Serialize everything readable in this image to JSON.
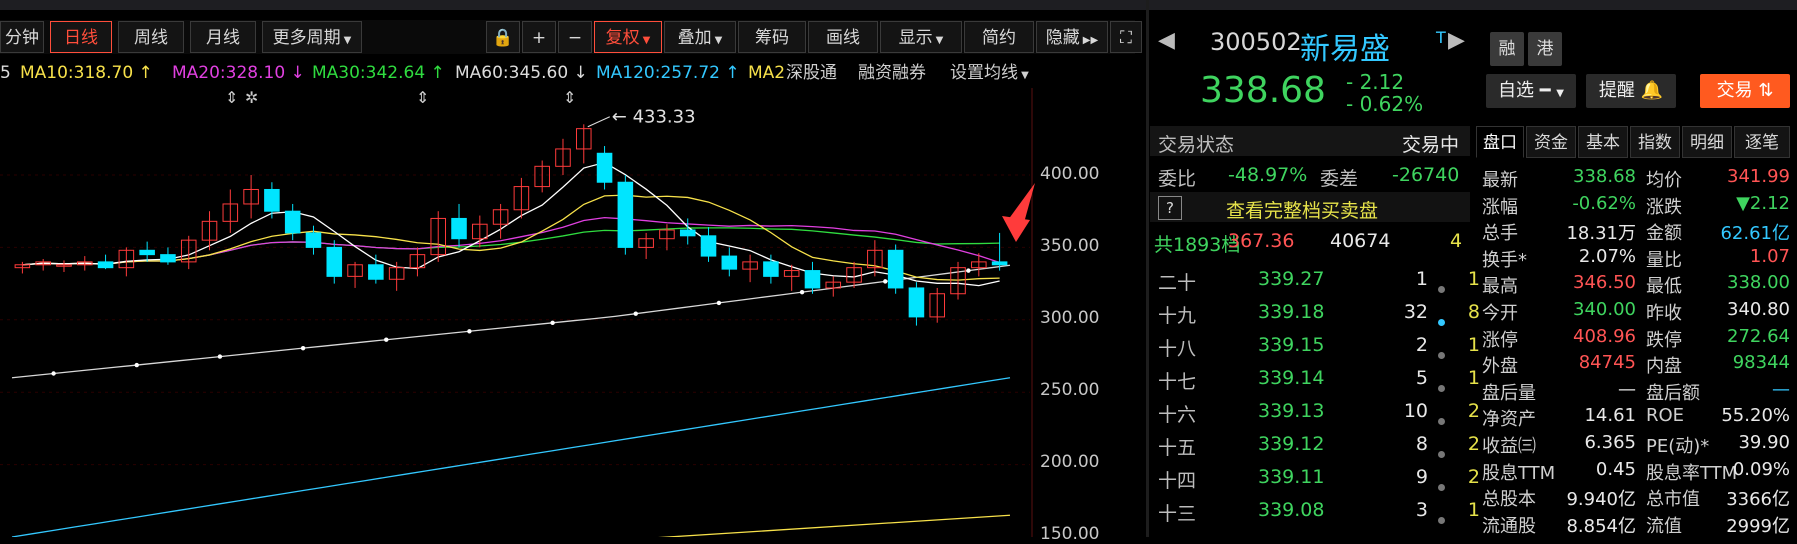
{
  "toolbar": {
    "items": [
      "分钟",
      "日线",
      "周线",
      "月线",
      "更多周期",
      "复权",
      "叠加",
      "筹码",
      "画线",
      "显示",
      "简约",
      "隐藏"
    ],
    "active": "日线"
  },
  "ma_line": [
    {
      "label": "5",
      "color": "#ffffff"
    },
    {
      "label": "MA10:318.70 ↑",
      "color": "#f7e14a"
    },
    {
      "label": "MA20:328.10 ↓",
      "color": "#e040e0"
    },
    {
      "label": "MA30:342.64 ↑",
      "color": "#2fdc3f"
    },
    {
      "label": "MA60:345.60 ↓",
      "color": "#dcdcdc"
    },
    {
      "label": "MA120:257.72 ↑",
      "color": "#33c8ff"
    },
    {
      "label": "MA2",
      "color": "#f7e14a"
    },
    {
      "label": "深股通",
      "color": "#cfcfcf"
    },
    {
      "label": "融资融券",
      "color": "#cfcfcf"
    },
    {
      "label": "设置均线",
      "color": "#cfcfcf"
    }
  ],
  "chart": {
    "y_ticks": [
      "400.00",
      "350.00",
      "300.00",
      "250.00",
      "200.00",
      "150.00"
    ],
    "high_annotation": "433.33"
  },
  "chart_data": {
    "type": "candlestick",
    "y_axis": [
      150,
      400
    ],
    "candles": [
      [
        336,
        340,
        332,
        338
      ],
      [
        338,
        342,
        334,
        340
      ],
      [
        337,
        341,
        333,
        338
      ],
      [
        338,
        344,
        334,
        340
      ],
      [
        340,
        345,
        335,
        336
      ],
      [
        336,
        350,
        330,
        348
      ],
      [
        348,
        354,
        340,
        345
      ],
      [
        345,
        350,
        338,
        340
      ],
      [
        340,
        358,
        335,
        355
      ],
      [
        355,
        375,
        348,
        368
      ],
      [
        368,
        390,
        360,
        380
      ],
      [
        380,
        400,
        370,
        390
      ],
      [
        390,
        395,
        370,
        375
      ],
      [
        375,
        380,
        355,
        360
      ],
      [
        360,
        365,
        345,
        350
      ],
      [
        350,
        355,
        325,
        330
      ],
      [
        330,
        340,
        322,
        338
      ],
      [
        338,
        345,
        325,
        328
      ],
      [
        328,
        340,
        320,
        336
      ],
      [
        336,
        350,
        330,
        345
      ],
      [
        345,
        375,
        340,
        370
      ],
      [
        370,
        380,
        350,
        356
      ],
      [
        356,
        372,
        350,
        366
      ],
      [
        366,
        380,
        356,
        376
      ],
      [
        376,
        398,
        370,
        392
      ],
      [
        392,
        410,
        388,
        406
      ],
      [
        406,
        425,
        400,
        418
      ],
      [
        418,
        435,
        408,
        432
      ],
      [
        415,
        420,
        390,
        395
      ],
      [
        395,
        400,
        345,
        350
      ],
      [
        350,
        360,
        342,
        356
      ],
      [
        356,
        366,
        348,
        362
      ],
      [
        362,
        370,
        352,
        358
      ],
      [
        358,
        364,
        340,
        344
      ],
      [
        344,
        350,
        330,
        335
      ],
      [
        335,
        345,
        326,
        340
      ],
      [
        340,
        345,
        325,
        330
      ],
      [
        330,
        338,
        320,
        334
      ],
      [
        334,
        340,
        318,
        322
      ],
      [
        322,
        330,
        316,
        326
      ],
      [
        326,
        340,
        322,
        336
      ],
      [
        336,
        355,
        330,
        348
      ],
      [
        348,
        352,
        318,
        322
      ],
      [
        322,
        326,
        296,
        302
      ],
      [
        302,
        322,
        298,
        318
      ],
      [
        318,
        340,
        314,
        336
      ],
      [
        336,
        346,
        330,
        340
      ],
      [
        340,
        360,
        334,
        338
      ]
    ],
    "ma_series": [
      {
        "name": "MA10",
        "color": "#f7e14a"
      },
      {
        "name": "MA20",
        "color": "#e040e0"
      },
      {
        "name": "MA30",
        "color": "#2fdc3f"
      },
      {
        "name": "MA60",
        "color": "#dcdcdc"
      },
      {
        "name": "MA120",
        "color": "#33c8ff"
      }
    ]
  },
  "stock": {
    "code": "300502",
    "name": "新易盛",
    "price": "338.68",
    "change": "- 2.12",
    "change_pct": "- 0.62%",
    "t_mark": "T",
    "tag1": "融",
    "tag2": "港",
    "watch_btn": "自选",
    "alert_btn": "提醒",
    "trade_btn": "交易"
  },
  "status": {
    "label": "交易状态",
    "value": "交易中"
  },
  "weibi": {
    "label": "委比",
    "value": "-48.97%",
    "diff_label": "委差",
    "diff_value": "-26740"
  },
  "full_book": "查看完整档买卖盘",
  "summary": {
    "label": "共1893档",
    "price": "367.36",
    "vol": "40674",
    "count": "4"
  },
  "quotes": [
    {
      "level": "二十",
      "price": "339.27",
      "vol": "1",
      "cnt": "1"
    },
    {
      "level": "十九",
      "price": "339.18",
      "vol": "32",
      "cnt": "8"
    },
    {
      "level": "十八",
      "price": "339.15",
      "vol": "2",
      "cnt": "1"
    },
    {
      "level": "十七",
      "price": "339.14",
      "vol": "5",
      "cnt": "1"
    },
    {
      "level": "十六",
      "price": "339.13",
      "vol": "10",
      "cnt": "2"
    },
    {
      "level": "十五",
      "price": "339.12",
      "vol": "8",
      "cnt": "2"
    },
    {
      "level": "十四",
      "price": "339.11",
      "vol": "9",
      "cnt": "2"
    },
    {
      "level": "十三",
      "price": "339.08",
      "vol": "3",
      "cnt": "1"
    }
  ],
  "tabs": [
    "盘口",
    "资金",
    "基本",
    "指数",
    "明细",
    "逐笔"
  ],
  "stats": [
    {
      "l1": "最新",
      "v1": "338.68",
      "c1": "green",
      "l2": "均价",
      "v2": "341.99",
      "c2": "red"
    },
    {
      "l1": "涨幅",
      "v1": "-0.62%",
      "c1": "green",
      "l2": "涨跌",
      "v2": "▼2.12",
      "c2": "green"
    },
    {
      "l1": "总手",
      "v1": "18.31万",
      "c1": "white",
      "l2": "金额",
      "v2": "62.61亿",
      "c2": "cyan"
    },
    {
      "l1": "换手*",
      "v1": "2.07%",
      "c1": "white",
      "l2": "量比",
      "v2": "1.07",
      "c2": "red"
    },
    {
      "l1": "最高",
      "v1": "346.50",
      "c1": "red",
      "l2": "最低",
      "v2": "338.00",
      "c2": "green"
    },
    {
      "l1": "今开",
      "v1": "340.00",
      "c1": "green",
      "l2": "昨收",
      "v2": "340.80",
      "c2": "white"
    },
    {
      "l1": "涨停",
      "v1": "408.96",
      "c1": "red",
      "l2": "跌停",
      "v2": "272.64",
      "c2": "green"
    },
    {
      "l1": "外盘",
      "v1": "84745",
      "c1": "red",
      "l2": "内盘",
      "v2": "98344",
      "c2": "green"
    },
    {
      "l1": "盘后量",
      "v1": "—",
      "c1": "white",
      "l2": "盘后额",
      "v2": "—",
      "c2": "cyan"
    },
    {
      "l1": "净资产",
      "v1": "14.61",
      "c1": "white",
      "l2": "ROE",
      "v2": "55.20%",
      "c2": "white"
    },
    {
      "l1": "收益㈢",
      "v1": "6.365",
      "c1": "white",
      "l2": "PE(动)*",
      "v2": "39.90",
      "c2": "white"
    },
    {
      "l1": "股息TTM",
      "v1": "0.45",
      "c1": "white",
      "l2": "股息率TTM",
      "v2": "0.09%",
      "c2": "white"
    },
    {
      "l1": "总股本",
      "v1": "9.940亿",
      "c1": "white",
      "l2": "总市值",
      "v2": "3366亿",
      "c2": "white"
    },
    {
      "l1": "流通股",
      "v1": "8.854亿",
      "c1": "white",
      "l2": "流值",
      "v2": "2999亿",
      "c2": "white"
    }
  ]
}
